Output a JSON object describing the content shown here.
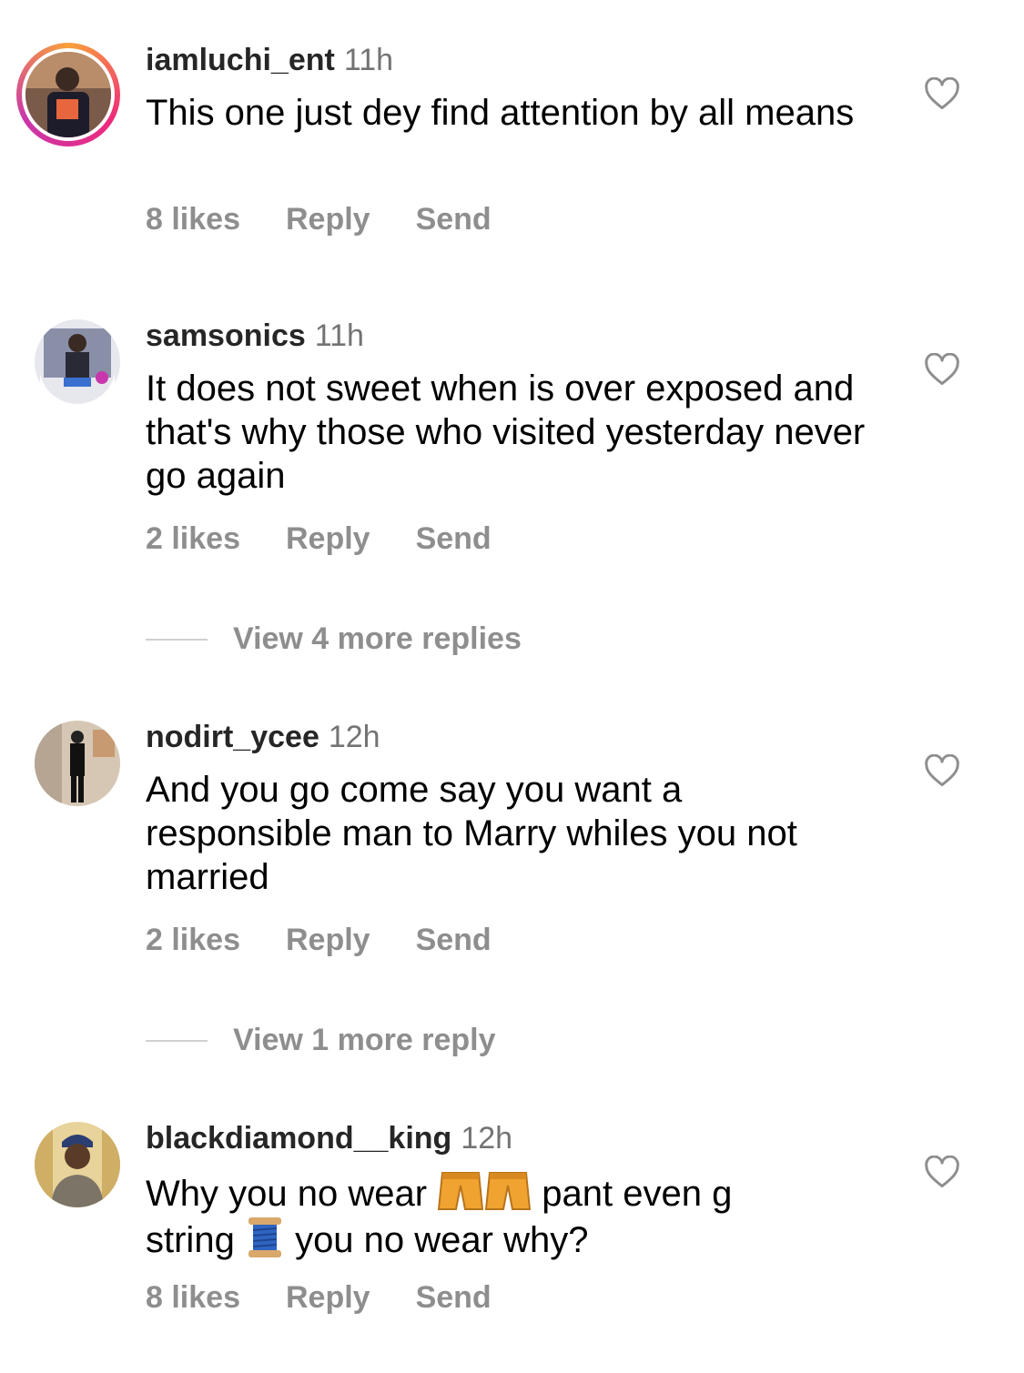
{
  "comments": [
    {
      "username": "iamluchi_ent",
      "time": "11h",
      "text": "This one just dey find attention by all means",
      "likes": "8 likes",
      "reply": "Reply",
      "send": "Send"
    },
    {
      "username": "samsonics",
      "time": "11h",
      "text": "It does not sweet when is over exposed and that's why those who visited yesterday never go again",
      "likes": "2 likes",
      "reply": "Reply",
      "send": "Send",
      "view_more": "View 4 more replies"
    },
    {
      "username": "nodirt_ycee",
      "time": "12h",
      "text": "And you go come say you want a responsible man to Marry whiles you not married",
      "likes": "2 likes",
      "reply": "Reply",
      "send": "Send",
      "view_more": "View 1 more reply"
    },
    {
      "username": "blackdiamond__king",
      "time": "12h",
      "text_part1": "Why you no wear",
      "text_part2": "pant even g",
      "text_part3": "string",
      "text_part4": "you no wear why?",
      "emojis": [
        "shorts-emoji",
        "shorts-emoji",
        "thread-spool-emoji"
      ],
      "likes": "8 likes",
      "reply": "Reply",
      "send": "Send"
    }
  ],
  "icons": {
    "like": "heart-outline-icon"
  },
  "colors": {
    "username": "#262626",
    "secondary": "#8e8e8e",
    "timestamp": "#737373"
  }
}
